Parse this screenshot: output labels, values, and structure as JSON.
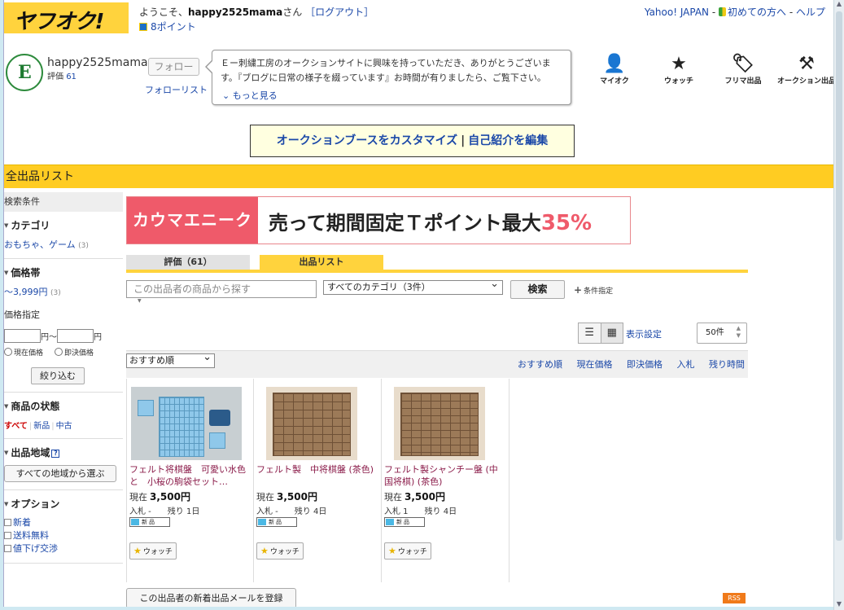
{
  "header": {
    "logo_text": "ヤフオク!",
    "welcome_prefix": "ようこそ、",
    "welcome_user": "happy2525mama",
    "welcome_suffix": "さん",
    "logout": "［ログアウト］",
    "points": "8ポイント",
    "top_links": {
      "yahoo": "Yahoo! JAPAN",
      "sep1": " - ",
      "beginner": "初めての方へ",
      "sep2": " - ",
      "help": "ヘルプ"
    }
  },
  "profile": {
    "name": "happy2525mama",
    "rating_label": "評価",
    "rating_value": "61",
    "follow_button": "フォロー",
    "follow_list": "フォローリスト",
    "intro_text": "Ｅー刺繍工房のオークションサイトに興味を持っていただき、ありがとうございます。『ブログに日常の様子を綴っています』お時間が有りましたら、ご覧下さい。",
    "more": "もっと見る"
  },
  "nav_icons": [
    {
      "label": "マイオク",
      "icon": "person-icon"
    },
    {
      "label": "ウォッチ",
      "icon": "star-icon"
    },
    {
      "label": "フリマ出品",
      "icon": "tag-icon"
    },
    {
      "label": "オークション出品",
      "icon": "gavel-icon"
    }
  ],
  "customize": {
    "left": "オークションブースをカスタマイズ",
    "sep": "|",
    "right": "自己紹介を編集"
  },
  "list_bar": "全出品リスト",
  "sidebar": {
    "title": "検索条件",
    "category_heading": "カテゴリ",
    "category_item": "おもちゃ、ゲーム",
    "category_count": "(3)",
    "price_heading": "価格帯",
    "price_item": "～3,999円",
    "price_count": "(3)",
    "price_spec": "価格指定",
    "yen_tilde": "円～",
    "yen": "円",
    "current_price": "現在価格",
    "buyout_price": "即決価格",
    "narrow_button": "絞り込む",
    "condition_heading": "商品の状態",
    "cond_all": "すべて",
    "cond_new": "新品",
    "cond_used": "中古",
    "region_heading": "出品地域",
    "region_button": "すべての地域から選ぶ",
    "option_heading": "オプション",
    "options": [
      "新着",
      "送料無料",
      "値下げ交渉"
    ]
  },
  "banner": {
    "left": "カウマエニーク",
    "main": "売って期間固定Ｔポイント最大",
    "pct": "35%"
  },
  "tabs": {
    "rating": "評価（61）",
    "listing": "出品リスト"
  },
  "search": {
    "placeholder": "この出品者の商品から探す",
    "category": "すべてのカテゴリ（3件）",
    "button": "検索",
    "cond_add": "条件指定"
  },
  "display": {
    "settings": "表示設定",
    "count": "50件"
  },
  "sort": {
    "select": "おすすめ順",
    "links": [
      "おすすめ順",
      "現在価格",
      "即決価格",
      "入札",
      "残り時間"
    ]
  },
  "items": [
    {
      "title": "フェルト将棋盤　可愛い水色 と　小桜の駒袋セット…",
      "price_label": "現在",
      "price": "3,500円",
      "bids": "入札 -",
      "remain": "残り 1日",
      "badge": "新品",
      "watch": "ウォッチ"
    },
    {
      "title": "フェルト製　中将棋盤 (茶色)",
      "price_label": "現在",
      "price": "3,500円",
      "bids": "入札 -",
      "remain": "残り 4日",
      "badge": "新品",
      "watch": "ウォッチ"
    },
    {
      "title": "フェルト製シャンチー盤 (中国将棋) (茶色)",
      "price_label": "現在",
      "price": "3,500円",
      "bids": "入札 1",
      "remain": "残り 4日",
      "badge": "新品",
      "watch": "ウォッチ"
    }
  ],
  "mail_button": "この出品者の新着出品メールを登録",
  "rss": "RSS"
}
